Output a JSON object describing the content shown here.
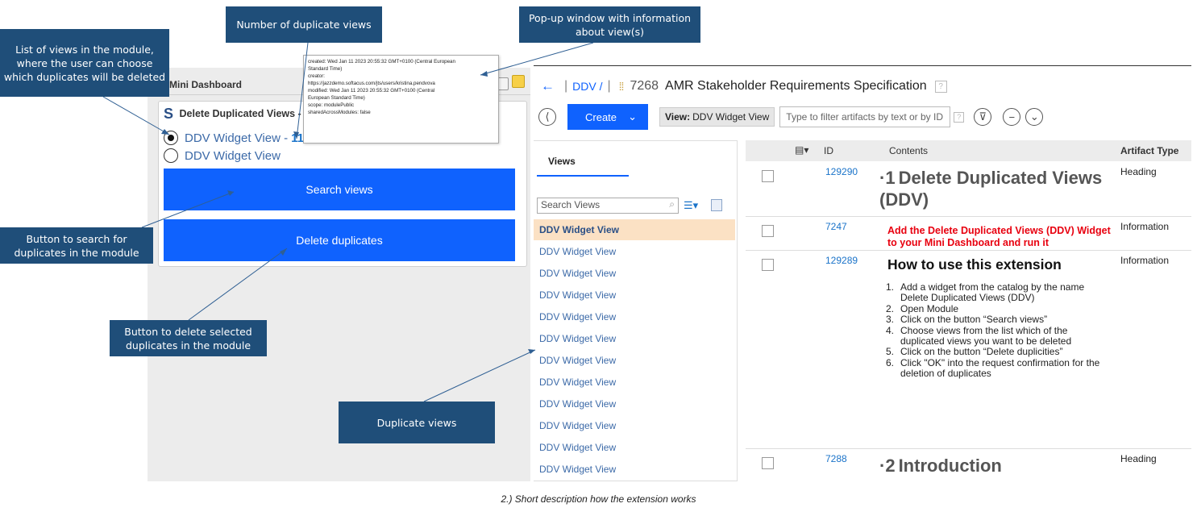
{
  "callouts": {
    "list_views": "List of views in the module, where the user can choose which duplicates will be deleted",
    "number_duplicates": "Number of duplicate views",
    "popup_info": "Pop-up window with information about view(s)",
    "search_button": "Button to search for duplicates in the module",
    "delete_button": "Button to delete selected duplicates in the module",
    "duplicate_views": "Duplicate views"
  },
  "dashboard": {
    "title": "Mini Dashboard",
    "widget_title": "Delete Duplicated Views - D",
    "options": [
      {
        "label": "DDV Widget View - ",
        "count": "11",
        "selected": true
      },
      {
        "label": "DDV Widget View",
        "count": "",
        "selected": false
      }
    ],
    "search_button": "Search views",
    "delete_button": "Delete duplicates"
  },
  "popup": {
    "lines": [
      "created: Wed Jan 11 2023 20:55:32 GMT+0100 (Central European",
      "Standard Time)",
      "creator:",
      "https://jazzdemo.softacus.com/jts/users/kristina.pendvova",
      "modified: Wed Jan 11 2023 20:55:32 GMT+0100 (Central",
      "European Standard Time)",
      "scope: modulePublic",
      "sharedAcrossModules: false"
    ]
  },
  "header": {
    "breadcrumb_project": "DDV /",
    "module_id": "7268",
    "module_title": "AMR Stakeholder Requirements Specification"
  },
  "toolbar": {
    "create_label": "Create",
    "view_label": "View:",
    "view_value": "DDV Widget View",
    "filter_placeholder": "Type to filter artifacts by text or by ID"
  },
  "views_pane": {
    "tab_label": "Views",
    "search_placeholder": "Search Views",
    "items": [
      "DDV Widget View",
      "DDV Widget View",
      "DDV Widget View",
      "DDV Widget View",
      "DDV Widget View",
      "DDV Widget View",
      "DDV Widget View",
      "DDV Widget View",
      "DDV Widget View",
      "DDV Widget View",
      "DDV Widget View",
      "DDV Widget View"
    ]
  },
  "table": {
    "columns": [
      "ID",
      "Contents",
      "Artifact Type"
    ],
    "rows": [
      {
        "id": "129290",
        "prefix": "·1",
        "content": "Delete Duplicated Views (DDV)",
        "type": "Heading"
      },
      {
        "id": "7247",
        "content": "Add the Delete Duplicated Views (DDV) Widget to your Mini Dashboard and run it",
        "type": "Information"
      },
      {
        "id": "129289",
        "content": "How to use this extension",
        "type": "Information"
      },
      {
        "id": "7288",
        "prefix": "·2",
        "content": "Introduction",
        "type": "Heading"
      }
    ],
    "steps": [
      {
        "n": "1.",
        "text": "Add a widget from the catalog by the name Delete Duplicated Views (DDV)"
      },
      {
        "n": "2.",
        "text": "Open Module"
      },
      {
        "n": "3.",
        "text": "Click on the button “Search views”"
      },
      {
        "n": "4.",
        "text": "Choose views from the list which of the duplicated views you want to be deleted"
      },
      {
        "n": "5.",
        "text": "Click on the button “Delete duplicities”"
      },
      {
        "n": "6.",
        "text": "Click \"OK\" into the request confirmation for the deletion of duplicates"
      }
    ]
  },
  "caption": "2.) Short description how the extension works",
  "colors": {
    "callout_bg": "#1f4e79",
    "primary_blue": "#0f62fe",
    "selected_row": "#fbe1c4",
    "warning_red": "#e8000f"
  }
}
